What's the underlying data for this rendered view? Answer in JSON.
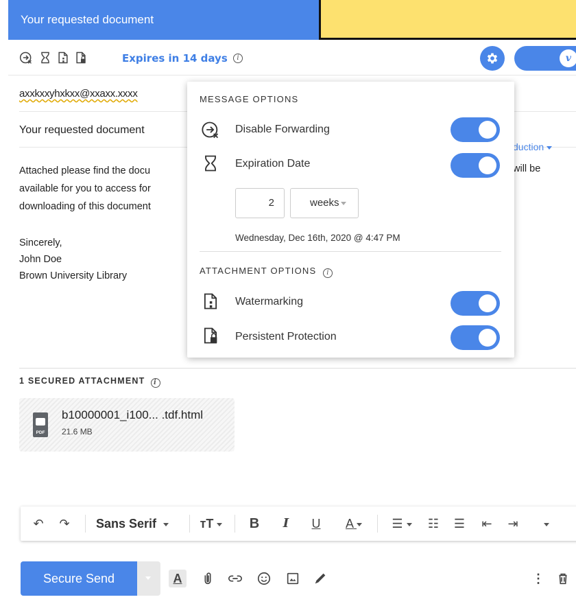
{
  "header": {
    "title": "Your requested document"
  },
  "secure_bar": {
    "icons": [
      "disable-forwarding-icon",
      "hourglass-icon",
      "watermark-icon",
      "persistent-protection-icon"
    ],
    "expires_label": "Expires in 14 days",
    "toggle_glyph": "v"
  },
  "email": {
    "recipient": "axxkxxyhxkxx@xxaxx.xxxx",
    "subject": "Your requested document",
    "body_lines": [
      "Attached please find the docu",
      "available for you to access for",
      "downloading of this document"
    ],
    "right_fragment_link": "duction",
    "right_fragment_text": "will be",
    "signature": [
      "Sincerely,",
      "John Doe",
      "Brown University Library"
    ]
  },
  "popover": {
    "message_options_title": "MESSAGE OPTIONS",
    "disable_forwarding_label": "Disable Forwarding",
    "expiration_date_label": "Expiration Date",
    "expiry_amount": "2",
    "expiry_unit": "weeks",
    "expiry_datetime": "Wednesday, Dec 16th, 2020 @ 4:47 PM",
    "attachment_options_title": "ATTACHMENT OPTIONS",
    "watermarking_label": "Watermarking",
    "persistent_protection_label": "Persistent Protection"
  },
  "attachments": {
    "heading": "1 SECURED ATTACHMENT",
    "file_name": "b10000001_i100... .tdf.html",
    "file_size": "21.6 MB",
    "file_type": "PDF"
  },
  "format_toolbar": {
    "font_name": "Sans Serif"
  },
  "compose": {
    "send_label": "Secure Send"
  },
  "colors": {
    "accent": "#4a86e8",
    "sticky": "#fde16f"
  }
}
